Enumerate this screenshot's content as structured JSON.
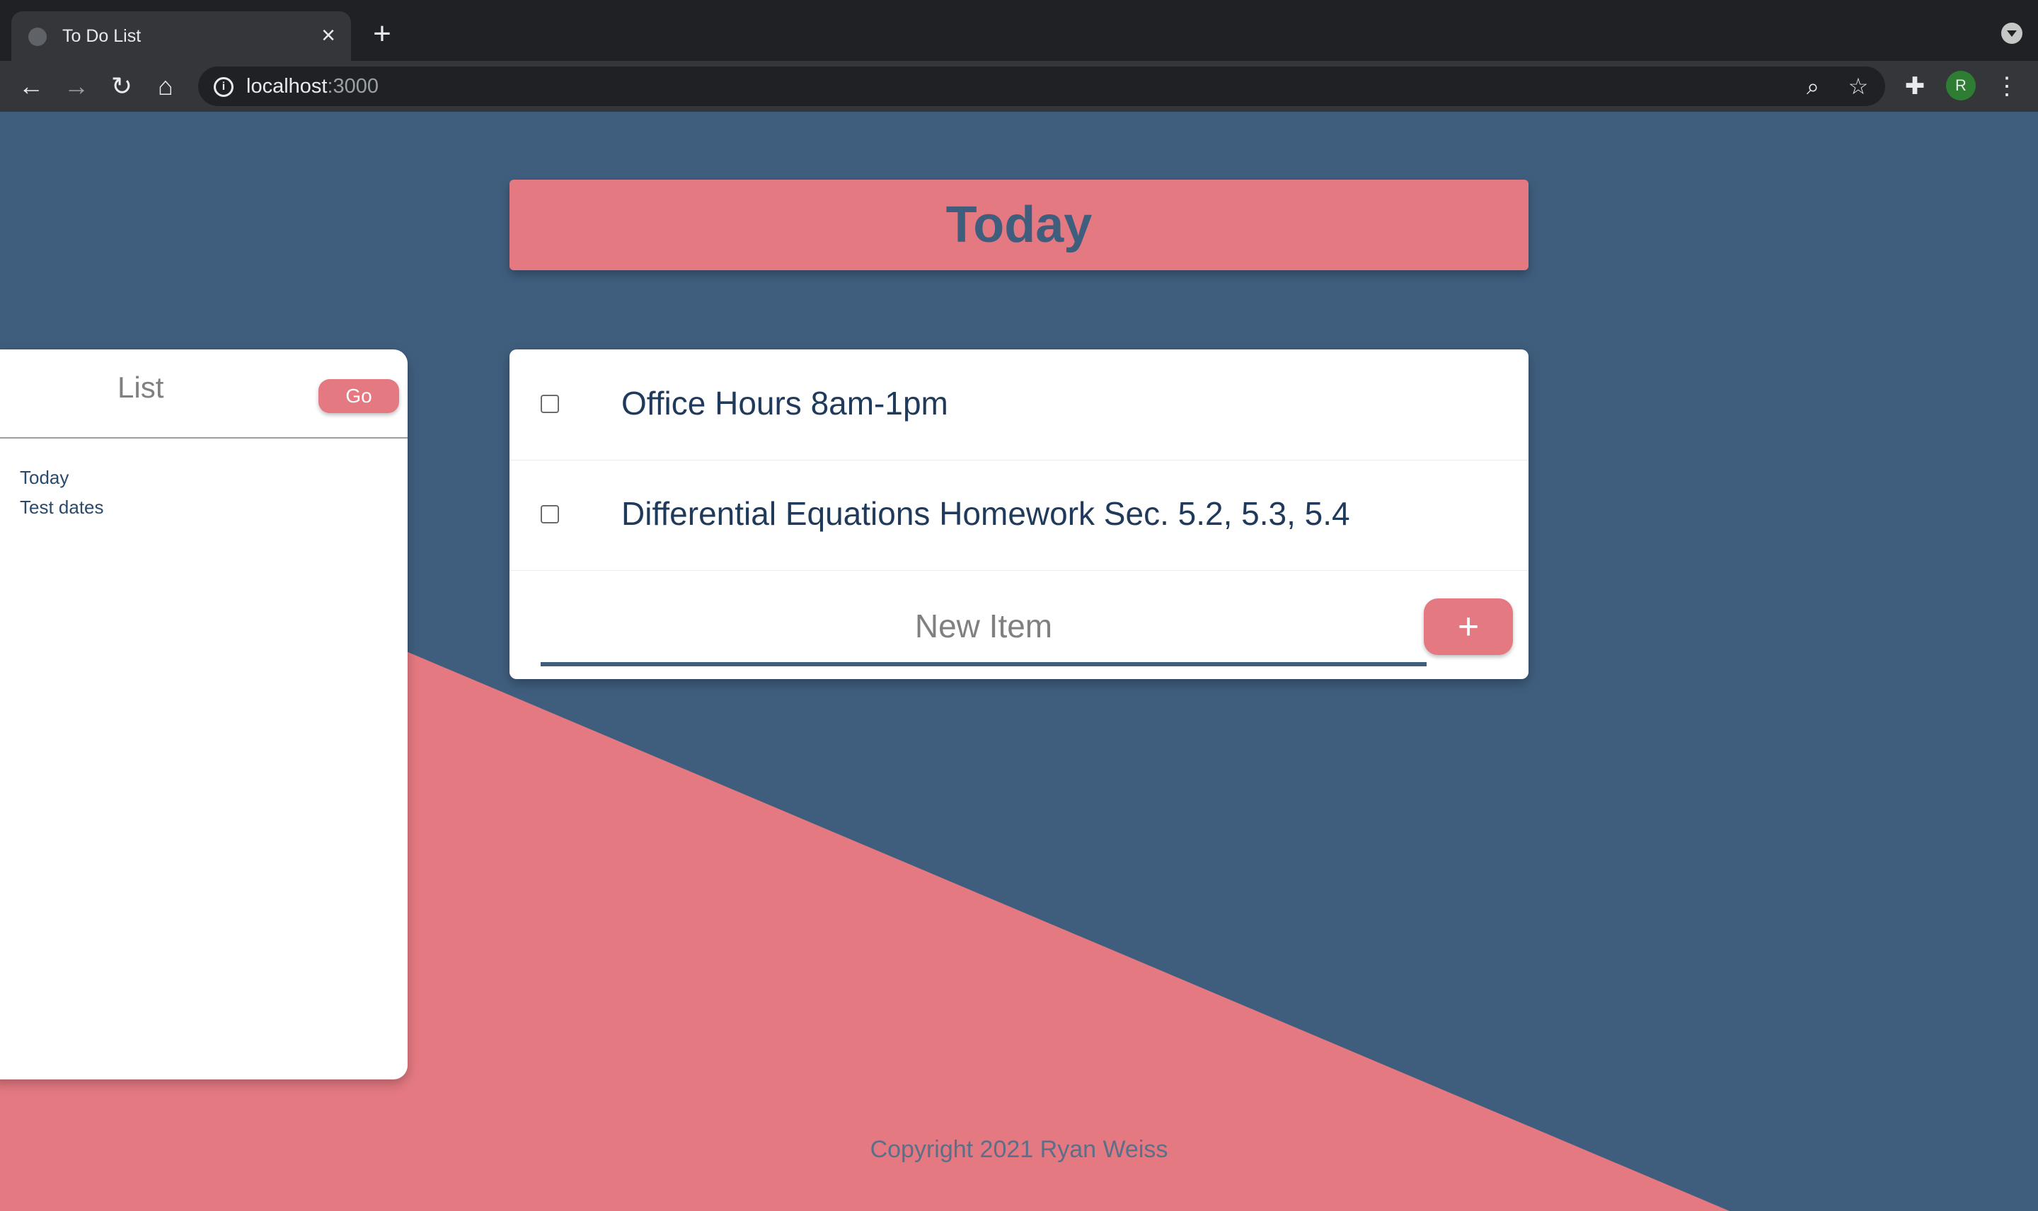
{
  "browser": {
    "tab_title": "To Do List",
    "tab_close_icon": "close-icon",
    "new_tab_icon": "plus-icon",
    "url_host": "localhost",
    "url_port": ":3000",
    "avatar_initial": "R",
    "avatar_color": "#2e7d32",
    "icons": [
      "back-arrow-icon",
      "forward-arrow-icon",
      "reload-icon",
      "home-icon",
      "info-icon",
      "zoom-icon",
      "star-icon",
      "extensions-icon",
      "more-vert-icon"
    ]
  },
  "colors": {
    "background": "#3f5e7e",
    "accent": "#e57982",
    "card": "#ffffff"
  },
  "header": {
    "title": "Today"
  },
  "sidebar": {
    "title": "List",
    "go_label": "Go",
    "items": [
      {
        "label": "Today"
      },
      {
        "label": "Test dates"
      }
    ]
  },
  "todo": {
    "items": [
      {
        "text": "Office Hours 8am-1pm",
        "checked": false
      },
      {
        "text": "Differential Equations Homework Sec. 5.2, 5.3, 5.4",
        "checked": false
      }
    ],
    "new_item_placeholder": "New Item",
    "add_label": "+"
  },
  "footer": {
    "text": "Copyright 2021 Ryan Weiss"
  }
}
